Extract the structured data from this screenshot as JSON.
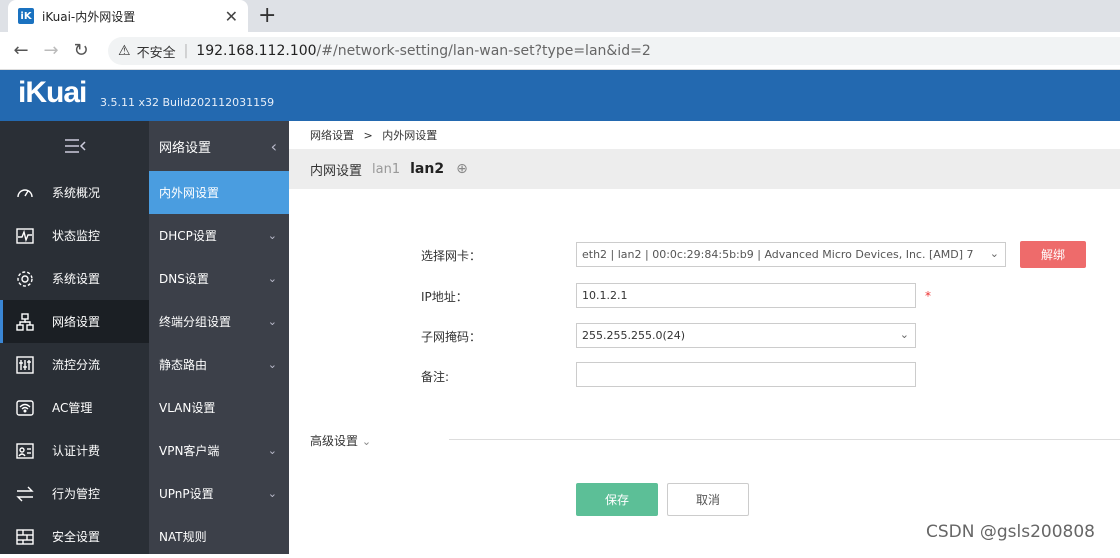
{
  "browser": {
    "tab_title": "iKuai-内外网设置",
    "tab_close": "✕",
    "new_tab": "+",
    "favicon_text": "iK",
    "security_text": "不安全",
    "url_host": "192.168.112.100",
    "url_path": "/#/network-setting/lan-wan-set?type=lan&id=2"
  },
  "header": {
    "logo": "iKuai",
    "version": "3.5.11 x32 Build202112031159"
  },
  "sidebar": {
    "items": [
      {
        "label": "系统概况",
        "icon": "dashboard-icon"
      },
      {
        "label": "状态监控",
        "icon": "monitor-icon"
      },
      {
        "label": "系统设置",
        "icon": "gear-icon"
      },
      {
        "label": "网络设置",
        "icon": "network-icon"
      },
      {
        "label": "流控分流",
        "icon": "sliders-icon"
      },
      {
        "label": "AC管理",
        "icon": "wifi-icon"
      },
      {
        "label": "认证计费",
        "icon": "auth-card-icon"
      },
      {
        "label": "行为管控",
        "icon": "arrows-icon"
      },
      {
        "label": "安全设置",
        "icon": "firewall-icon"
      }
    ]
  },
  "subnav": {
    "title": "网络设置",
    "items": [
      {
        "label": "内外网设置"
      },
      {
        "label": "DHCP设置"
      },
      {
        "label": "DNS设置"
      },
      {
        "label": "终端分组设置"
      },
      {
        "label": "静态路由"
      },
      {
        "label": "VLAN设置"
      },
      {
        "label": "VPN客户端"
      },
      {
        "label": "UPnP设置"
      },
      {
        "label": "NAT规则"
      }
    ]
  },
  "main": {
    "breadcrumb": [
      "网络设置",
      ">",
      "内外网设置"
    ],
    "lan_title": "内网设置",
    "lan_tabs": [
      "lan1",
      "lan2"
    ],
    "add_symbol": "⊕",
    "form": {
      "nic_label": "选择网卡：",
      "nic_value": "eth2 | lan2 | 00:0c:29:84:5b:b9 | Advanced Micro Devices, Inc. [AMD] 7",
      "unbind_label": "解绑",
      "ip_label": "IP地址：",
      "ip_value": "10.1.2.1",
      "required_mark": "*",
      "mask_label": "子网掩码：",
      "mask_value": "255.255.255.0(24)",
      "note_label": "备注:",
      "note_value": ""
    },
    "advanced_label": "高级设置",
    "save_label": "保存",
    "cancel_label": "取消"
  },
  "watermark": "CSDN @gsls200808"
}
